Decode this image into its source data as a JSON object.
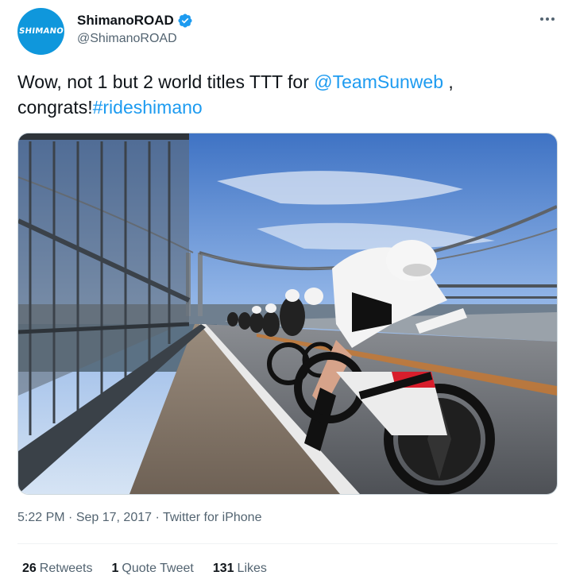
{
  "author": {
    "display_name": "ShimanoROAD",
    "handle": "@ShimanoROAD",
    "avatar_text": "SHIMANO",
    "avatar_color": "#0f97dc",
    "verified_badge_color": "#1d9bf0"
  },
  "tweet": {
    "text_part1": "Wow, not 1 but 2 world titles TTT for ",
    "mention": "@TeamSunweb",
    "text_part2": " ,",
    "text_part3": "congrats!",
    "hashtag": "#rideshimano",
    "photo_icon": "photo-cyclists-on-bridge"
  },
  "meta": {
    "time": "5:22 PM",
    "date": "Sep 17, 2017",
    "source": "Twitter for iPhone",
    "separator": "·"
  },
  "stats": {
    "retweets_count": "26",
    "retweets_label": "Retweets",
    "quotes_count": "1",
    "quotes_label": "Quote Tweet",
    "likes_count": "131",
    "likes_label": "Likes"
  },
  "icons": {
    "more": "more-horizontal-icon",
    "verified": "verified-badge-icon"
  }
}
